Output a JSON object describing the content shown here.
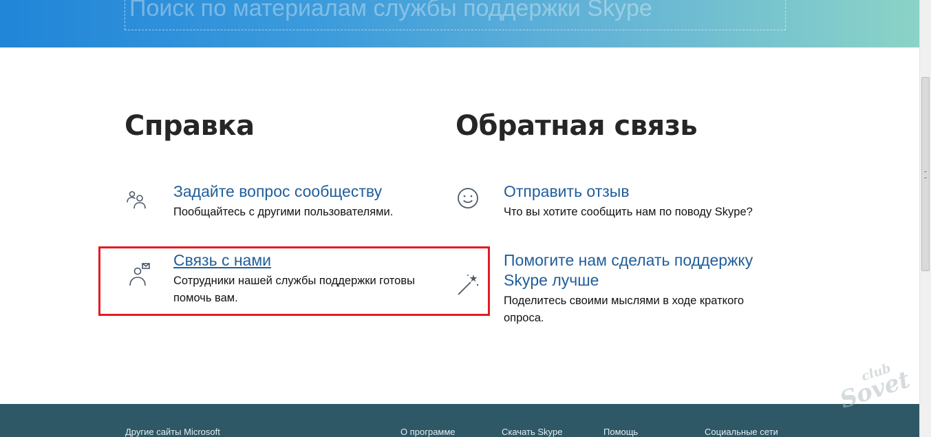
{
  "search": {
    "placeholder": "Поиск по материалам службы поддержки Skype"
  },
  "help": {
    "title": "Справка",
    "items": [
      {
        "icon": "community-icon",
        "link": "Задайте вопрос сообществу",
        "desc": "Пообщайтесь с другими пользователями."
      },
      {
        "icon": "contact-us-icon",
        "link": "Связь с нами",
        "desc": "Сотрудники нашей службы поддержки готовы помочь вам."
      }
    ]
  },
  "feedback": {
    "title": "Обратная связь",
    "items": [
      {
        "icon": "smiley-icon",
        "link": "Отправить отзыв",
        "desc": "Что вы хотите сообщить нам по поводу Skype?"
      },
      {
        "icon": "magic-wand-icon",
        "link": "Помогите нам сделать поддержку Skype лучше",
        "desc": "Поделитесь своими мыслями в ходе краткого опроса."
      }
    ]
  },
  "footer": {
    "links": [
      "Другие сайты Microsoft",
      "О программе",
      "Скачать Skype",
      "Помощь",
      "Социальные сети"
    ]
  },
  "watermark": {
    "line1": "club",
    "line2": "Sovet"
  },
  "colors": {
    "accent_link": "#215e9b",
    "highlight": "#e41b23",
    "footer_bg": "#2e5866"
  }
}
